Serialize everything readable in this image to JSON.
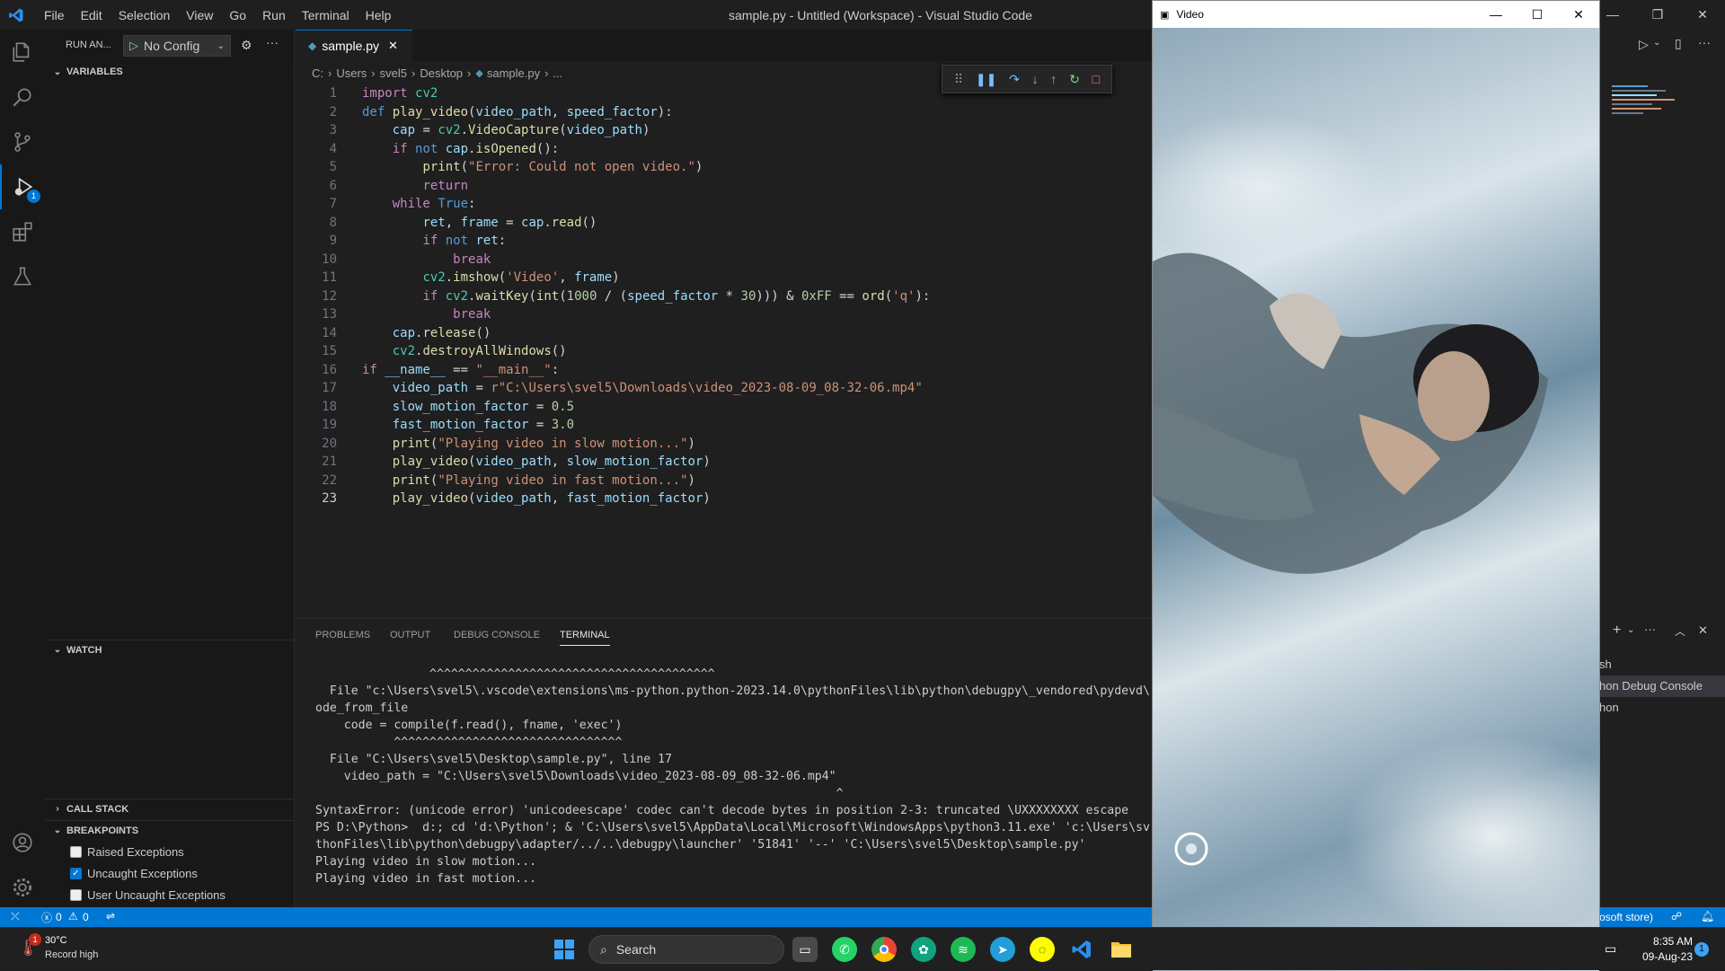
{
  "titlebar": {
    "menu": [
      "File",
      "Edit",
      "Selection",
      "View",
      "Go",
      "Run",
      "Terminal",
      "Help"
    ],
    "title": "sample.py - Untitled (Workspace) - Visual Studio Code"
  },
  "activity": {
    "debug_badge": "1"
  },
  "sidebar": {
    "run_label": "RUN AN...",
    "config": "No Config",
    "sections": {
      "variables": "VARIABLES",
      "watch": "WATCH",
      "call_stack": "CALL STACK",
      "breakpoints": "BREAKPOINTS"
    },
    "breakpoints": [
      {
        "label": "Raised Exceptions",
        "checked": false
      },
      {
        "label": "Uncaught Exceptions",
        "checked": true
      },
      {
        "label": "User Uncaught Exceptions",
        "checked": false
      }
    ]
  },
  "editor": {
    "tab": "sample.py",
    "breadcrumb": [
      "C:",
      "Users",
      "svel5",
      "Desktop",
      "sample.py",
      "..."
    ],
    "lines": [
      "import cv2",
      "def play_video(video_path, speed_factor):",
      "    cap = cv2.VideoCapture(video_path)",
      "    if not cap.isOpened():",
      "        print(\"Error: Could not open video.\")",
      "        return",
      "    while True:",
      "        ret, frame = cap.read()",
      "        if not ret:",
      "            break",
      "        cv2.imshow('Video', frame)",
      "        if cv2.waitKey(int(1000 / (speed_factor * 30))) & 0xFF == ord('q'):",
      "            break",
      "    cap.release()",
      "    cv2.destroyAllWindows()",
      "if __name__ == \"__main__\":",
      "    video_path = r\"C:\\Users\\svel5\\Downloads\\video_2023-08-09_08-32-06.mp4\"",
      "    slow_motion_factor = 0.5",
      "    fast_motion_factor = 3.0",
      "    print(\"Playing video in slow motion...\")",
      "    play_video(video_path, slow_motion_factor)",
      "    print(\"Playing video in fast motion...\")",
      "    play_video(video_path, fast_motion_factor)"
    ],
    "current_line": 23
  },
  "panel": {
    "tabs": [
      "PROBLEMS",
      "OUTPUT",
      "DEBUG CONSOLE",
      "TERMINAL"
    ],
    "active_tab": "TERMINAL",
    "terminal": [
      "                ^^^^^^^^^^^^^^^^^^^^^^^^^^^^^^^^^^^^^^^^",
      "  File \"c:\\Users\\svel5\\.vscode\\extensions\\ms-python.python-2023.14.0\\pythonFiles\\lib\\python\\debugpy\\_vendored\\pydevd\\",
      "ode_from_file",
      "    code = compile(f.read(), fname, 'exec')",
      "           ^^^^^^^^^^^^^^^^^^^^^^^^^^^^^^^^",
      "  File \"C:\\Users\\svel5\\Desktop\\sample.py\", line 17",
      "    video_path = \"C:\\Users\\svel5\\Downloads\\video_2023-08-09_08-32-06.mp4\"",
      "                                                                         ^",
      "SyntaxError: (unicode error) 'unicodeescape' codec can't decode bytes in position 2-3: truncated \\UXXXXXXXX escape",
      "PS D:\\Python>  d:; cd 'd:\\Python'; & 'C:\\Users\\svel5\\AppData\\Local\\Microsoft\\WindowsApps\\python3.11.exe' 'c:\\Users\\sv",
      "thonFiles\\lib\\python\\debugpy\\adapter/../..\\debugpy\\launcher' '51841' '--' 'C:\\Users\\svel5\\Desktop\\sample.py'",
      "Playing video in slow motion...",
      "Playing video in fast motion..."
    ],
    "right_list": [
      "sh",
      "hon Debug Console",
      "hon"
    ]
  },
  "statusbar": {
    "errors": "0",
    "warnings": "0",
    "right_text": "osoft store)"
  },
  "video_window": {
    "title": "Video"
  },
  "taskbar": {
    "weather_temp": "30°C",
    "weather_desc": "Record high",
    "weather_badge": "1",
    "search_label": "Search",
    "time": "8:35 AM",
    "date": "09-Aug-23",
    "notif_badge": "1"
  },
  "colors": {
    "accent": "#0078d4",
    "status_bar": "#0078d4"
  }
}
